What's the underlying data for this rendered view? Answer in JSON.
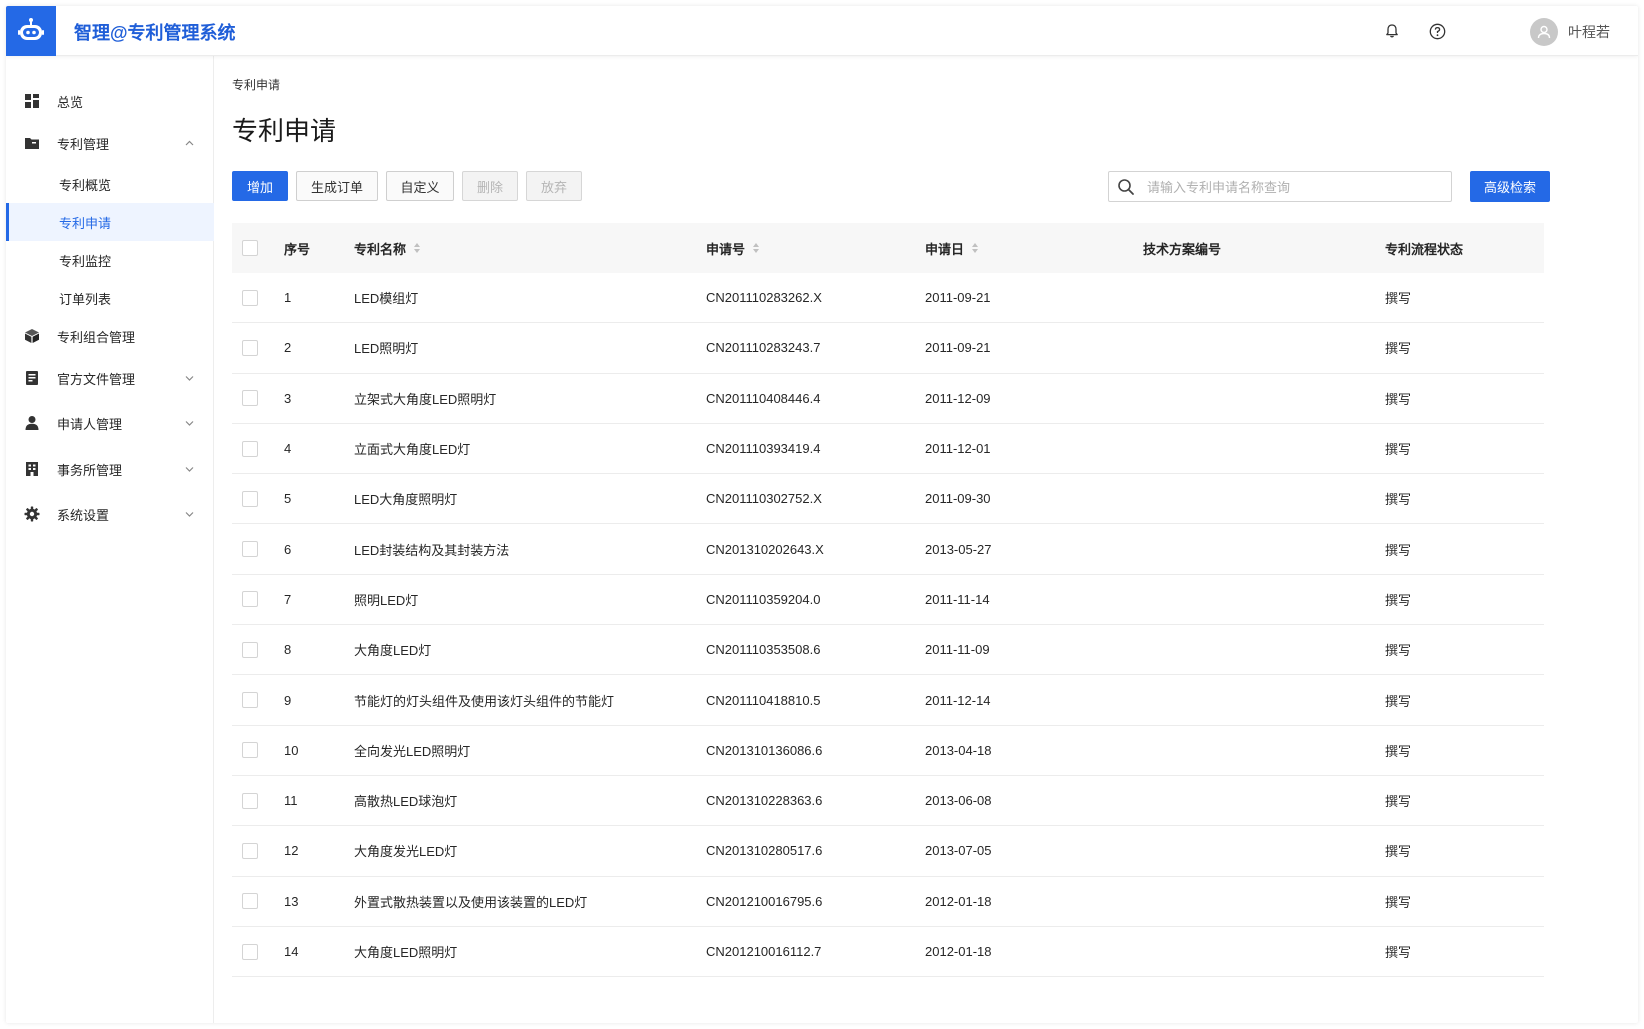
{
  "app": {
    "title": "智理@专利管理系统",
    "user": "叶程若"
  },
  "sidebar": {
    "items": [
      {
        "label": "总览",
        "icon": "dashboard-grid-icon"
      },
      {
        "label": "专利管理",
        "icon": "folder-icon",
        "expanded": true
      },
      {
        "label": "专利概览",
        "sub": true
      },
      {
        "label": "专利申请",
        "sub": true,
        "active": true
      },
      {
        "label": "专利监控",
        "sub": true
      },
      {
        "label": "订单列表",
        "sub": true
      },
      {
        "label": "专利组合管理",
        "icon": "cube-icon"
      },
      {
        "label": "官方文件管理",
        "icon": "document-icon"
      },
      {
        "label": "申请人管理",
        "icon": "person-icon"
      },
      {
        "label": "事务所管理",
        "icon": "building-icon"
      },
      {
        "label": "系统设置",
        "icon": "gear-icon"
      }
    ]
  },
  "main": {
    "breadcrumb": "专利申请",
    "title": "专利申请",
    "toolbar": {
      "add": "增加",
      "generate_order": "生成订单",
      "customize": "自定义",
      "delete": "删除",
      "abandon": "放弃",
      "search_placeholder": "请输入专利申请名称查询",
      "advanced_search": "高级检索"
    },
    "table": {
      "headers": {
        "index": "序号",
        "name": "专利名称",
        "app_no": "申请号",
        "app_date": "申请日",
        "tech_no": "技术方案编号",
        "status": "专利流程状态"
      },
      "rows": [
        {
          "index": "1",
          "name": "LED模组灯",
          "app_no": "CN201110283262.X",
          "app_date": "2011-09-21",
          "tech_no": "",
          "status": "撰写"
        },
        {
          "index": "2",
          "name": "LED照明灯",
          "app_no": "CN201110283243.7",
          "app_date": "2011-09-21",
          "tech_no": "",
          "status": "撰写"
        },
        {
          "index": "3",
          "name": "立架式大角度LED照明灯",
          "app_no": "CN201110408446.4",
          "app_date": "2011-12-09",
          "tech_no": "",
          "status": "撰写"
        },
        {
          "index": "4",
          "name": "立面式大角度LED灯",
          "app_no": "CN201110393419.4",
          "app_date": "2011-12-01",
          "tech_no": "",
          "status": "撰写"
        },
        {
          "index": "5",
          "name": "LED大角度照明灯",
          "app_no": "CN201110302752.X",
          "app_date": "2011-09-30",
          "tech_no": "",
          "status": "撰写"
        },
        {
          "index": "6",
          "name": "LED封装结构及其封装方法",
          "app_no": "CN201310202643.X",
          "app_date": "2013-05-27",
          "tech_no": "",
          "status": "撰写"
        },
        {
          "index": "7",
          "name": "照明LED灯",
          "app_no": "CN201110359204.0",
          "app_date": "2011-11-14",
          "tech_no": "",
          "status": "撰写"
        },
        {
          "index": "8",
          "name": "大角度LED灯",
          "app_no": "CN201110353508.6",
          "app_date": "2011-11-09",
          "tech_no": "",
          "status": "撰写"
        },
        {
          "index": "9",
          "name": "节能灯的灯头组件及使用该灯头组件的节能灯",
          "app_no": "CN201110418810.5",
          "app_date": "2011-12-14",
          "tech_no": "",
          "status": "撰写"
        },
        {
          "index": "10",
          "name": "全向发光LED照明灯",
          "app_no": "CN201310136086.6",
          "app_date": "2013-04-18",
          "tech_no": "",
          "status": "撰写"
        },
        {
          "index": "11",
          "name": "高散热LED球泡灯",
          "app_no": "CN201310228363.6",
          "app_date": "2013-06-08",
          "tech_no": "",
          "status": "撰写"
        },
        {
          "index": "12",
          "name": "大角度发光LED灯",
          "app_no": "CN201310280517.6",
          "app_date": "2013-07-05",
          "tech_no": "",
          "status": "撰写"
        },
        {
          "index": "13",
          "name": "外置式散热装置以及使用该装置的LED灯",
          "app_no": "CN201210016795.6",
          "app_date": "2012-01-18",
          "tech_no": "",
          "status": "撰写"
        },
        {
          "index": "14",
          "name": "大角度LED照明灯",
          "app_no": "CN201210016112.7",
          "app_date": "2012-01-18",
          "tech_no": "",
          "status": "撰写"
        }
      ]
    }
  },
  "colors": {
    "primary": "#2469e6",
    "header_bg": "#f7f7f7",
    "active_bg": "#eef4ff"
  }
}
